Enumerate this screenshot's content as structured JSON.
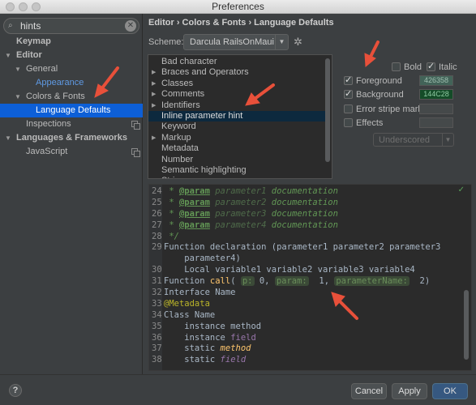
{
  "window": {
    "title": "Preferences"
  },
  "search": {
    "value": "hints"
  },
  "sidebar": {
    "items": [
      {
        "label": "Keymap",
        "level": 0,
        "bold": true
      },
      {
        "label": "Editor",
        "level": 0,
        "bold": true,
        "arrow": "▼"
      },
      {
        "label": "General",
        "level": 1,
        "arrow": "▼"
      },
      {
        "label": "Appearance",
        "level": 2,
        "link": true
      },
      {
        "label": "Colors & Fonts",
        "level": 1,
        "arrow": "▼"
      },
      {
        "label": "Language Defaults",
        "level": 2,
        "selected": true
      },
      {
        "label": "Inspections",
        "level": 1,
        "copy": true
      },
      {
        "label": "Languages & Frameworks",
        "level": 0,
        "bold": true,
        "arrow": "▼"
      },
      {
        "label": "JavaScript",
        "level": 1,
        "copy": true
      }
    ]
  },
  "breadcrumb": "Editor › Colors & Fonts › Language Defaults",
  "scheme": {
    "label": "Scheme:",
    "value": "Darcula RailsOnMaui"
  },
  "attributes": {
    "items": [
      {
        "label": "Bad character"
      },
      {
        "label": "Braces and Operators",
        "arrow": "▶"
      },
      {
        "label": "Classes",
        "arrow": "▶"
      },
      {
        "label": "Comments",
        "arrow": "▶"
      },
      {
        "label": "Identifiers",
        "arrow": "▶"
      },
      {
        "label": "Inline parameter hint",
        "selected": true
      },
      {
        "label": "Keyword"
      },
      {
        "label": "Markup",
        "arrow": "▶"
      },
      {
        "label": "Metadata"
      },
      {
        "label": "Number"
      },
      {
        "label": "Semantic highlighting"
      },
      {
        "label": "String",
        "arrow": "▶"
      }
    ]
  },
  "options": {
    "bold": "Bold",
    "italic": "Italic",
    "foreground": "Foreground",
    "foreground_color": "426358",
    "background": "Background",
    "background_color": "144C28",
    "error_stripe": "Error stripe mark",
    "effects": "Effects",
    "effects_type": "Underscored"
  },
  "colors": {
    "accent": "#0d5fd7",
    "arrow": "#e8503a",
    "foreground": "#426358",
    "background": "#144C28"
  },
  "code_lines": [
    {
      "n": "24",
      "segs": [
        {
          "c": "doc",
          "t": " * "
        },
        {
          "c": "doctag",
          "t": "@param"
        },
        {
          "c": "dim",
          "t": " parameter1 "
        },
        {
          "c": "doc",
          "t": "documentation"
        }
      ]
    },
    {
      "n": "25",
      "segs": [
        {
          "c": "doc",
          "t": " * "
        },
        {
          "c": "doctag",
          "t": "@param"
        },
        {
          "c": "dim",
          "t": " parameter2 "
        },
        {
          "c": "doc",
          "t": "documentation"
        }
      ]
    },
    {
      "n": "26",
      "segs": [
        {
          "c": "doc",
          "t": " * "
        },
        {
          "c": "doctag",
          "t": "@param"
        },
        {
          "c": "dim",
          "t": " parameter3 "
        },
        {
          "c": "doc",
          "t": "documentation"
        }
      ]
    },
    {
      "n": "27",
      "segs": [
        {
          "c": "doc",
          "t": " * "
        },
        {
          "c": "doctag",
          "t": "@param"
        },
        {
          "c": "dim",
          "t": " parameter4 "
        },
        {
          "c": "doc",
          "t": "documentation"
        }
      ]
    },
    {
      "n": "28",
      "segs": [
        {
          "c": "doc",
          "t": " */"
        }
      ]
    },
    {
      "n": "29",
      "segs": [
        {
          "c": "",
          "t": "Function declaration (parameter1 parameter2 parameter3"
        }
      ]
    },
    {
      "n": "",
      "segs": [
        {
          "c": "",
          "t": "    parameter4)"
        }
      ]
    },
    {
      "n": "30",
      "segs": [
        {
          "c": "",
          "t": "    Local variable1 variable2 variable3 variable4"
        }
      ]
    },
    {
      "n": "31",
      "segs": [
        {
          "c": "",
          "t": "Function "
        },
        {
          "c": "fn",
          "t": "call"
        },
        {
          "c": "",
          "t": "( "
        },
        {
          "c": "hint",
          "t": "p:"
        },
        {
          "c": "",
          "t": " 0, "
        },
        {
          "c": "hint",
          "t": "param:"
        },
        {
          "c": "",
          "t": "  1, "
        },
        {
          "c": "hint",
          "t": "parameterName:"
        },
        {
          "c": "",
          "t": "  2)"
        }
      ]
    },
    {
      "n": "32",
      "segs": [
        {
          "c": "",
          "t": "Interface Name"
        }
      ]
    },
    {
      "n": "33",
      "segs": [
        {
          "c": "meta",
          "t": "@Metadata"
        }
      ]
    },
    {
      "n": "34",
      "segs": [
        {
          "c": "",
          "t": "Class Name"
        }
      ]
    },
    {
      "n": "35",
      "segs": [
        {
          "c": "",
          "t": "    instance method"
        }
      ]
    },
    {
      "n": "36",
      "segs": [
        {
          "c": "",
          "t": "    instance "
        },
        {
          "c": "fieldc",
          "t": "field"
        }
      ]
    },
    {
      "n": "37",
      "segs": [
        {
          "c": "",
          "t": "    static "
        },
        {
          "c": "method-it",
          "t": "method"
        }
      ]
    },
    {
      "n": "38",
      "segs": [
        {
          "c": "",
          "t": "    static "
        },
        {
          "c": "ital",
          "t": "field"
        }
      ]
    }
  ],
  "buttons": {
    "help": "?",
    "cancel": "Cancel",
    "apply": "Apply",
    "ok": "OK"
  }
}
